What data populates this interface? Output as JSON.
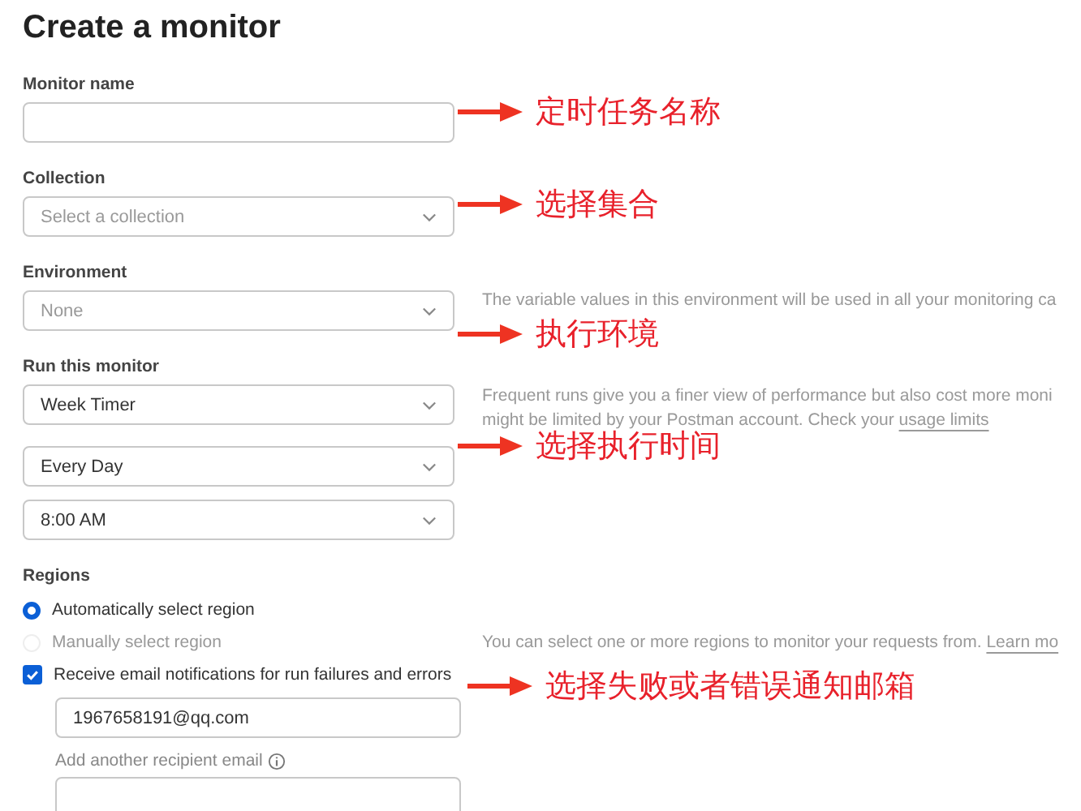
{
  "title": "Create a monitor",
  "fields": [
    {
      "kind": "text",
      "label": "Monitor name"
    },
    {
      "kind": "select",
      "label": "Collection",
      "placeholder": "Select a collection"
    },
    {
      "kind": "select",
      "label": "Environment",
      "placeholder": "None",
      "help": "The variable values in this environment will be used in all your monitoring ca"
    }
  ],
  "schedule": {
    "label": "Run this monitor",
    "selects": [
      "Week Timer",
      "Every Day",
      "8:00 AM"
    ],
    "help": "Frequent runs give you a finer view of performance but also cost more moni",
    "help_line_2": "might be limited by your Postman account. Check your",
    "link": "usage limits"
  },
  "regions": {
    "label": "Regions",
    "options": [
      {
        "label": "Automatically select region",
        "selected": true,
        "disabled": false
      },
      {
        "label": "Manually select region",
        "selected": false,
        "disabled": true
      }
    ],
    "help": "You can select one or more regions to monitor your requests from.",
    "link": "Learn mo"
  },
  "notify": {
    "label": "Receive email notifications for run failures and errors",
    "checked": true,
    "email": "1967658191@qq.com",
    "add_label": "Add another recipient email"
  },
  "annotations": [
    "定时任务名称",
    "选择集合",
    "执行环境",
    "选择执行时间",
    "选择失败或者错误通知邮箱"
  ]
}
